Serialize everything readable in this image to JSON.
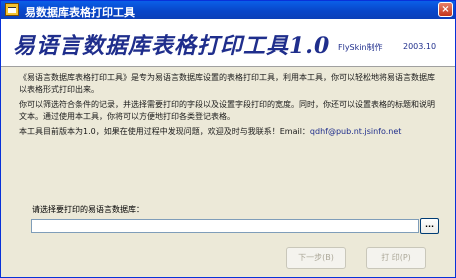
{
  "window": {
    "title": "易数据库表格打印工具",
    "close_label": "×",
    "icon": "database-icon"
  },
  "header": {
    "app_name": "易语言数据库表格打印工具1.0",
    "credit": "FlySkin制作",
    "date": "2003.10"
  },
  "description": {
    "para1": "《易语言数据库表格打印工具》是专为易语言数据库设置的表格打印工具，利用本工具，你可以轻松地将易语言数据库以表格形式打印出来。",
    "para2": "你可以筛选符合条件的记录，并选择需要打印的字段以及设置字段打印的宽度。同时，你还可以设置表格的标题和说明文本。通过使用本工具，你将可以方便地打印各类登记表格。",
    "para3_prefix": "本工具目前版本为1.0，如果在使用过程中发现问题，欢迎及时与我联系！Email：",
    "email": "qdhf@pub.nt.jsinfo.net"
  },
  "form": {
    "prompt_label": "请选择要打印的易语言数据库：",
    "path_value": "",
    "browse_label": "..."
  },
  "buttons": {
    "next": "下一步(B)",
    "print": "打 印(P)"
  }
}
